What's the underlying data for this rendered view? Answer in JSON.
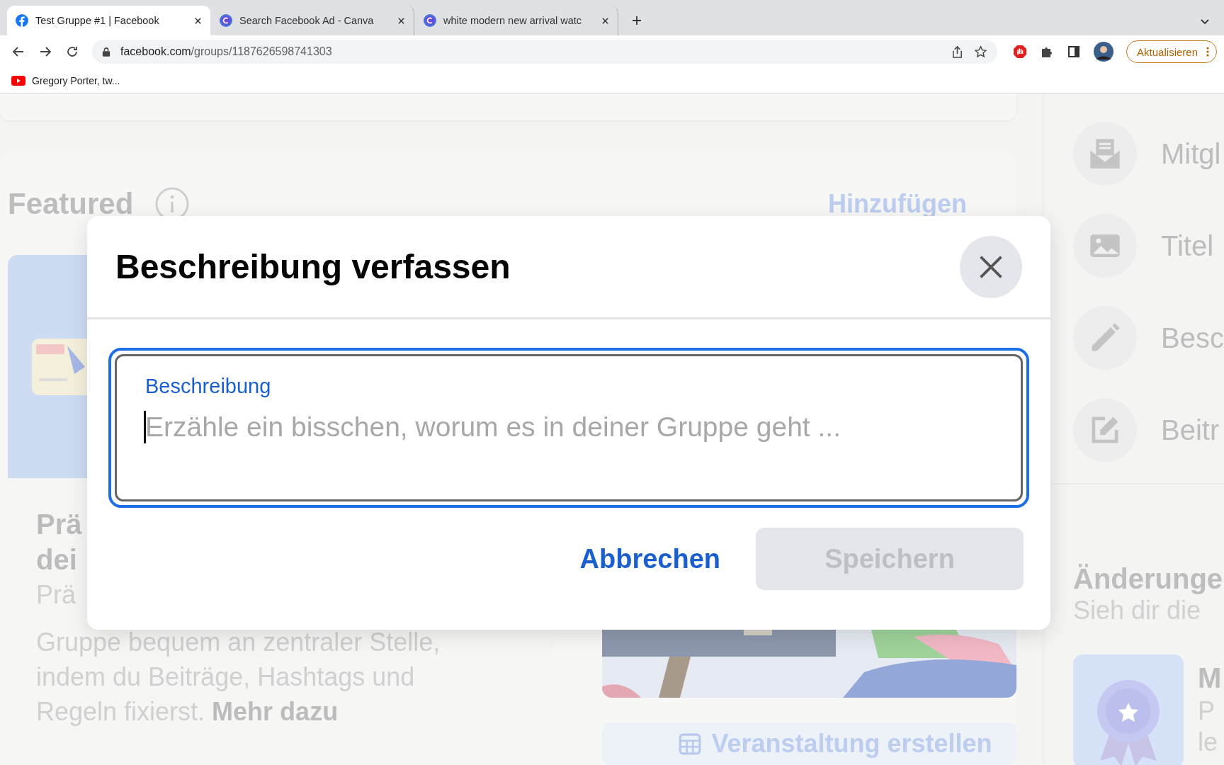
{
  "browser": {
    "tabs": [
      {
        "kind": "facebook",
        "title": "Test Gruppe #1 | Facebook",
        "selected": true
      },
      {
        "kind": "canva",
        "title": "Search Facebook Ad - Canva",
        "selected": false
      },
      {
        "kind": "canva",
        "title": "white modern new arrival watc",
        "selected": false
      }
    ],
    "url": {
      "host": "facebook.com",
      "path": "/groups/1187626598741303"
    },
    "update_button": "Aktualisieren",
    "bookmarks": [
      {
        "kind": "youtube",
        "label": "Gregory Porter, tw..."
      }
    ]
  },
  "page": {
    "featured": {
      "title": "Featured",
      "action": "Hinzufügen",
      "card": {
        "title_lines": [
          "Prä",
          "dei"
        ],
        "text_lines": [
          "Prä",
          "Gruppe bequem an zentraler Stelle,",
          "indem du Beiträge, Hashtags und",
          "Regeln fixierst. **Mehr dazu**"
        ]
      },
      "event_button": "Veranstaltung erstellen"
    },
    "side_items": [
      {
        "kind": "invite",
        "label": "Mitgl"
      },
      {
        "kind": "cover",
        "label": "Titel"
      },
      {
        "kind": "pencil",
        "label": "Besc"
      },
      {
        "kind": "edit",
        "label": "Beitr"
      }
    ],
    "changes": {
      "title": "Änderunge",
      "subtitle": "Sieh dir die",
      "item": {
        "title": "M",
        "lines": [
          "P",
          "le"
        ]
      }
    }
  },
  "dialog": {
    "title": "Beschreibung verfassen",
    "field": {
      "label": "Beschreibung",
      "placeholder": "Erzähle ein bisschen, worum es in deiner Gruppe geht ...",
      "focused": true
    },
    "cancel": "Abbrechen",
    "save": {
      "label": "Speichern",
      "disabled": true
    }
  }
}
